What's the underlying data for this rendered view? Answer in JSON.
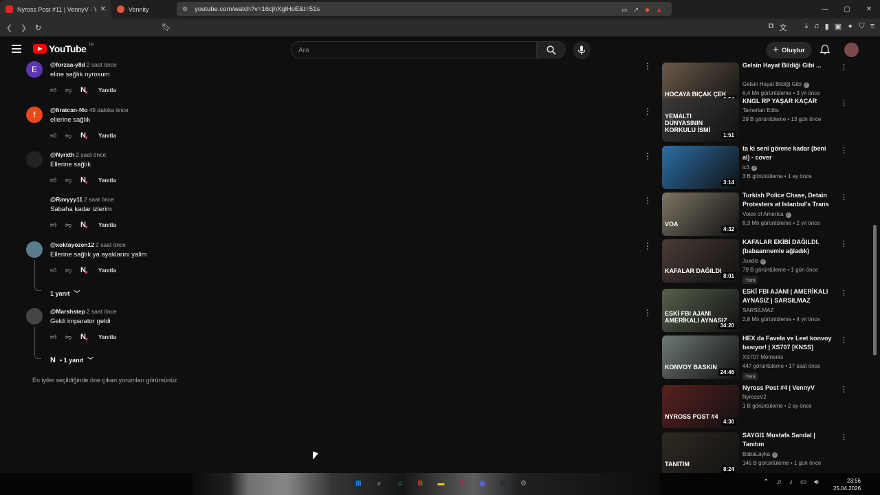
{
  "browser": {
    "tabs": [
      {
        "title": "Nyross Post #11 | VennyV - YouTube",
        "active": true,
        "favicon_color": "#e22"
      },
      {
        "title": "Vennity",
        "active": false,
        "favicon_color": "#e8533a"
      }
    ],
    "new_tab": "+",
    "window_controls": {
      "minimize": "—",
      "maximize": "▢",
      "close": "✕"
    },
    "url": "youtube.com/watch?v=16cjhXglHoE&t=51s"
  },
  "youtube": {
    "logo_text": "YouTube",
    "country_code": "TR",
    "search_placeholder": "Ara",
    "create_label": "Oluştur"
  },
  "comments": [
    {
      "handle": "@forzaa-y8d",
      "time": "2 saat önce",
      "text": "eline sağlık nyrosum",
      "avatar_letter": "E",
      "avatar_color": "#5e35b1",
      "reply_label": "Yanıtla"
    },
    {
      "handle": "@fıratcan-f4o",
      "time": "49 dakika önce",
      "text": "ellerine sağlık",
      "avatar_letter": "f",
      "avatar_color": "#e64a19",
      "reply_label": "Yanıtla"
    },
    {
      "handle": "@Nyrxth",
      "time": "2 saat önce",
      "text": "Ellerine sağlık",
      "avatar_letter": "",
      "avatar_color": "#222222",
      "reply_label": "Yanıtla"
    },
    {
      "handle": "@Ravyyy11",
      "time": "2 saat önce",
      "text": "Sabaha kadar izlerim",
      "avatar_letter": "",
      "avatar_color": "#0f0f0f",
      "reply_label": "Yanıtla"
    },
    {
      "handle": "@xoktayozen12",
      "time": "2 saat önce",
      "text": "Ellerine sağlık ya ayaklarını yalim",
      "avatar_letter": "",
      "avatar_color": "#5a7d8c",
      "reply_label": "Yanıtla",
      "replies_label": "1 yanıt"
    },
    {
      "handle": "@Marshstep",
      "time": "2 saat önce",
      "text": "Geldi imparator geldi",
      "avatar_letter": "",
      "avatar_color": "#444444",
      "reply_label": "Yanıtla",
      "replies_label": "• 1 yanıt"
    }
  ],
  "comments_info": "En iyiler seçildiğinde öne çıkan yorumları görürsünüz",
  "recommendations": [
    {
      "title": "Gelsin Hayat Bildiği Gibi ...",
      "channel": "Gelsin Hayat Bildiği Gibi",
      "verified": true,
      "meta": "6,4 Mn görüntüleme • 3 yıl önce",
      "duration": "6:54",
      "thumb_color": "#6b5a4a",
      "thumb_text": "HOCAYA BIÇAK ÇEK"
    },
    {
      "title": "KNGL RP YAŞAR KAÇAR",
      "channel": "Tamerlan Edits",
      "verified": false,
      "meta": "29 B görüntüleme • 13 gün önce",
      "duration": "1:51",
      "thumb_color": "#3a3a3a",
      "thumb_text": "YEMALTI DÜNYASININ KORKULU İSMİ"
    },
    {
      "title": "ta ki seni görene kadar (beni al) - cover",
      "channel": "ic3",
      "verified": true,
      "meta": "3 B görüntüleme • 1 ay önce",
      "duration": "3:14",
      "thumb_color": "#2a6fa8",
      "thumb_text": ""
    },
    {
      "title": "Turkish Police Chase, Detain Protesters at Istanbul's Trans ...",
      "channel": "Voice of America",
      "verified": true,
      "meta": "8,3 Mn görüntüleme • 2 yıl önce",
      "duration": "4:32",
      "thumb_color": "#7d7564",
      "thumb_text": "VOA"
    },
    {
      "title": "KAFALAR EKİBİ DAĞILDI. (babaannemle ağladık)",
      "channel": "Juadis",
      "verified": true,
      "meta": "79 B görüntüleme • 1 gün önce",
      "duration": "8:01",
      "thumb_color": "#4a3b35",
      "thumb_text": "KAFALAR DAĞILDI",
      "badge": "Yeni"
    },
    {
      "title": "ESKİ FBI AJANI | AMERİKALI AYNASIZ | SARSILMAZ",
      "channel": "SARSILMAZ",
      "verified": false,
      "meta": "2,8 Mn görüntüleme • 4 yıl önce",
      "duration": "34:20",
      "thumb_color": "#55604a",
      "thumb_text": "ESKİ FBI AJANI AMERİKALI AYNASIZ"
    },
    {
      "title": "HEX da Favela ve Leet konvoy basıyor! | XS707 [KNSS]",
      "channel": "XS707 Moments",
      "verified": false,
      "meta": "447 görüntüleme • 17 saat önce",
      "duration": "24:46",
      "thumb_color": "#6f7a74",
      "thumb_text": "KONVOY BASKIN",
      "badge": "Yeni"
    },
    {
      "title": "Nyross Post #4 | VennyV",
      "channel": "NyrossV2",
      "verified": false,
      "meta": "1 B görüntüleme • 2 ay önce",
      "duration": "4:30",
      "thumb_color": "#5a1f1f",
      "thumb_text": "NYROSS POST #4"
    },
    {
      "title": "SAYGI1 Mustafa Sandal | Tanıtım",
      "channel": "BabaLayka",
      "verified": true,
      "meta": "145 B görüntüleme • 1 gün önce",
      "duration": "8:24",
      "thumb_color": "#2f2a22",
      "thumb_text": "TANITIM"
    }
  ],
  "taskbar": {
    "time": "23:56",
    "date": "25.04.2026",
    "apps": [
      {
        "name": "windows-start",
        "glyph": "⊞",
        "color": "#1e90ff"
      },
      {
        "name": "search",
        "glyph": "⌕",
        "color": "#888888"
      },
      {
        "name": "spotify",
        "glyph": "♫",
        "color": "#1db954"
      },
      {
        "name": "brave",
        "glyph": "B",
        "color": "#fb542b"
      },
      {
        "name": "file-explorer",
        "glyph": "▬",
        "color": "#f4c430"
      },
      {
        "name": "app-a",
        "glyph": "A",
        "color": "#c2185b"
      },
      {
        "name": "discord",
        "glyph": "◉",
        "color": "#5865f2"
      },
      {
        "name": "steam",
        "glyph": "⚙",
        "color": "#1b2838"
      },
      {
        "name": "settings",
        "glyph": "⚙",
        "color": "#777777"
      }
    ]
  }
}
